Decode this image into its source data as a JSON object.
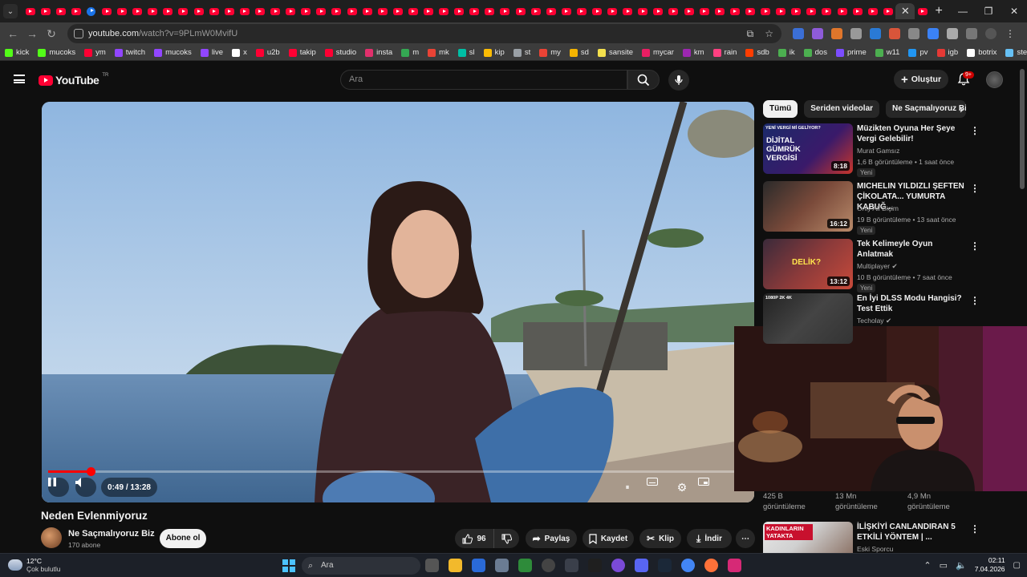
{
  "browser": {
    "url_host": "youtube.com",
    "url_path": "/watch?v=9PLmW0MvifU",
    "window_controls": [
      "—",
      "❐",
      "✕"
    ]
  },
  "bookmarks": [
    {
      "label": "kick",
      "color": "#53fc18"
    },
    {
      "label": "mucoks",
      "color": "#53fc18"
    },
    {
      "label": "ym",
      "color": "#ff0033"
    },
    {
      "label": "twitch",
      "color": "#9146ff"
    },
    {
      "label": "mucoks",
      "color": "#9146ff"
    },
    {
      "label": "live",
      "color": "#9146ff"
    },
    {
      "label": "x",
      "color": "#ffffff"
    },
    {
      "label": "u2b",
      "color": "#ff0033"
    },
    {
      "label": "takip",
      "color": "#ff0033"
    },
    {
      "label": "studio",
      "color": "#ff0033"
    },
    {
      "label": "insta",
      "color": "#e1306c"
    },
    {
      "label": "m",
      "color": "#34a853"
    },
    {
      "label": "mk",
      "color": "#ea4335"
    },
    {
      "label": "sl",
      "color": "#00bfa5"
    },
    {
      "label": "kip",
      "color": "#fbbc04"
    },
    {
      "label": "st",
      "color": "#9aa0a6"
    },
    {
      "label": "my",
      "color": "#ea4335"
    },
    {
      "label": "sd",
      "color": "#f4b400"
    },
    {
      "label": "sansite",
      "color": "#f4e04d"
    },
    {
      "label": "mycar",
      "color": "#e91e63"
    },
    {
      "label": "km",
      "color": "#9c27b0"
    },
    {
      "label": "rain",
      "color": "#ff4081"
    },
    {
      "label": "sdb",
      "color": "#ff3d00"
    },
    {
      "label": "ik",
      "color": "#4caf50"
    },
    {
      "label": "dos",
      "color": "#4caf50"
    },
    {
      "label": "prime",
      "color": "#7c4dff"
    },
    {
      "label": "w11",
      "color": "#4caf50"
    },
    {
      "label": "pv",
      "color": "#2196f3"
    },
    {
      "label": "igb",
      "color": "#e53935"
    },
    {
      "label": "botrix",
      "color": "#ffffff"
    },
    {
      "label": "steam",
      "color": "#66c0f4"
    }
  ],
  "youtube": {
    "logo_text": "YouTube",
    "logo_region": "TR",
    "search_placeholder": "Ara",
    "create_label": "Oluştur",
    "notif_badge": "9+"
  },
  "player": {
    "time_current": "0:49",
    "time_total": "13:28",
    "progress": 0.061
  },
  "video": {
    "title": "Neden Evlenmiyoruz",
    "channel": "Ne Saçmalıyoruz Biz",
    "subs": "170 abone",
    "subscribe_label": "Abone ol",
    "likes": "96",
    "share_label": "Paylaş",
    "save_label": "Kaydet",
    "clip_label": "Klip",
    "download_label": "İndir"
  },
  "chips": [
    "Tümü",
    "Seriden videolar",
    "Ne Saçmalıyoruz Biz"
  ],
  "recommendations": [
    {
      "title": "Müzikten Oyuna Her Şeye Vergi Gelebilir!",
      "channel": "Murat Gamsız",
      "meta": "1,6 B görüntüleme • 1 saat önce",
      "badge": "Yeni",
      "duration": "8:18",
      "thumb_text": "DİJİTAL GÜMRÜK VERGİSİ",
      "thumb_top": "YENİ VERGİ Mİ GELİYOR?",
      "verified": false
    },
    {
      "title": "MICHELIN YILDIZLI ŞEFTEN ÇİKOLATA... YUMURTA KABUĞ...",
      "channel": "Only Ali Biçim",
      "meta": "19 B görüntüleme • 13 saat önce",
      "badge": "Yeni",
      "duration": "16:12",
      "thumb_text": "",
      "thumb_top": "",
      "verified": false
    },
    {
      "title": "Tek Kelimeyle Oyun Anlatmak",
      "channel": "Multiplayer",
      "meta": "10 B görüntüleme • 7 saat önce",
      "badge": "Yeni",
      "duration": "13:12",
      "thumb_text": "DELİK?",
      "thumb_top": "",
      "verified": true
    },
    {
      "title": "En İyi DLSS Modu Hangisi? Test Ettik",
      "channel": "Techolay",
      "meta": "",
      "badge": "",
      "duration": "",
      "thumb_text": "",
      "thumb_top": "1080P 2K 4K",
      "verified": true
    },
    {
      "title": "İLİŞKİYİ CANLANDIRAN 5 ETKİLİ YÖNTEM | ...",
      "channel": "Eski Sporcu",
      "meta": "",
      "badge": "",
      "duration": "",
      "thumb_text": "KADINLARIN YATAKTA",
      "thumb_top": "",
      "verified": false
    }
  ],
  "stats_row": [
    {
      "value": "425 B",
      "label": "görüntüleme"
    },
    {
      "value": "13 Mn",
      "label": "görüntüleme"
    },
    {
      "value": "4,9 Mn",
      "label": "görüntüleme"
    }
  ],
  "taskbar": {
    "temp": "12°C",
    "weather": "Çok bulutlu",
    "search_placeholder": "Ara",
    "time": "02:11",
    "date": "7.04.2026"
  },
  "colors": {
    "accent": "#ff0033",
    "bg": "#0f0f0f"
  }
}
